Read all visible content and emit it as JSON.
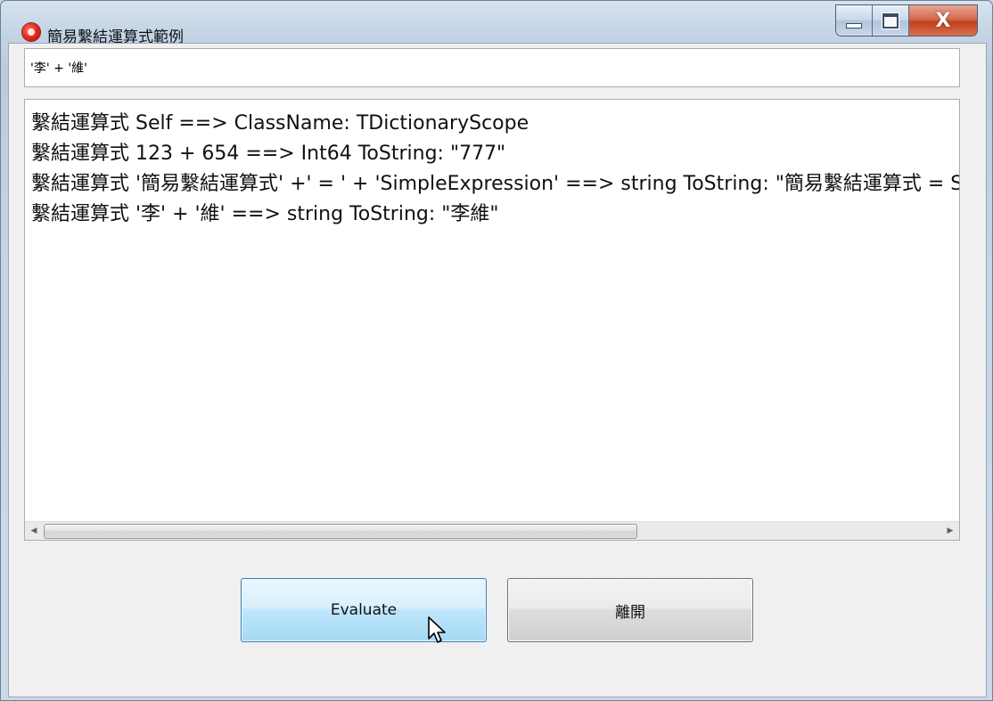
{
  "window": {
    "title": "簡易繫結運算式範例",
    "caption": {
      "close_label": "X"
    }
  },
  "expression_input": {
    "value": "'李' + '維'"
  },
  "output": {
    "lines": [
      "繫結運算式 Self ==>  ClassName: TDictionaryScope",
      "繫結運算式 123 + 654 ==>  Int64 ToString: \"777\"",
      "繫結運算式 '簡易繫結運算式' +' = ' + 'SimpleExpression' ==>  string ToString: \"簡易繫結運算式 = SimpleExpression\"",
      "繫結運算式 '李' + '維' ==>  string ToString: \"李維\""
    ]
  },
  "buttons": {
    "evaluate_label": "Evaluate",
    "exit_label": "離開"
  },
  "icons": {
    "app": "app-logo-icon",
    "minimize": "minimize-icon",
    "maximize": "maximize-icon",
    "close": "close-icon",
    "scroll_left": "chevron-left-icon",
    "scroll_right": "chevron-right-icon",
    "cursor": "mouse-pointer-icon"
  },
  "colors": {
    "window_frame": "#c3d3e4",
    "close_button": "#c2401f",
    "evaluate_button_hover": "#bee6fd"
  }
}
